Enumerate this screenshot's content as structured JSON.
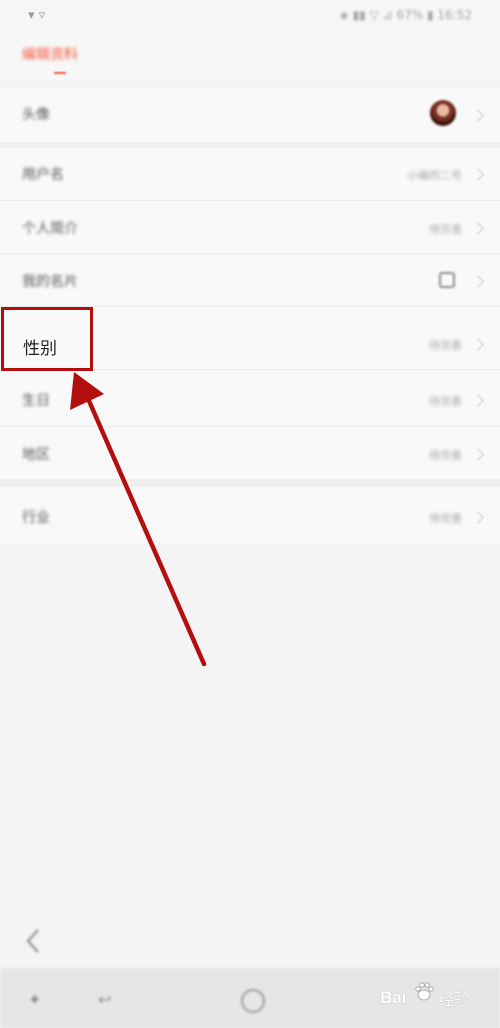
{
  "status_bar": {
    "carrier_icon": "wifi-signal-icon",
    "right_text": "◈ ▮▮ ▽ ⊿ 67% ▮ 16:52"
  },
  "header": {
    "title": "编辑资料",
    "accent_color": "#f25a3c"
  },
  "rows": [
    {
      "label": "头像",
      "value": "",
      "kind": "avatar"
    },
    {
      "label": "用户名",
      "value": "小编的二号",
      "kind": "value"
    },
    {
      "label": "个人简介",
      "value": "待完善",
      "kind": "value"
    },
    {
      "label": "我的名片",
      "value": "",
      "kind": "qr"
    },
    {
      "label": "性别",
      "value": "待完善",
      "kind": "value"
    },
    {
      "label": "生日",
      "value": "待完善",
      "kind": "value"
    },
    {
      "label": "地区",
      "value": "待完善",
      "kind": "value"
    },
    {
      "label": "行业",
      "value": "待完善",
      "kind": "value"
    }
  ],
  "annotation": {
    "highlighted_label": "性别",
    "box_color": "#b40f0f",
    "arrow_color": "#b40f0f"
  },
  "nav": {
    "back_icon": "back-chevron-icon",
    "menu_icon": "menu-icon",
    "back_nav_icon": "back-arrow-icon",
    "home_icon": "home-circle-icon"
  },
  "watermark": {
    "bai": "Bai",
    "du": "度",
    "jingyan": "经验"
  }
}
